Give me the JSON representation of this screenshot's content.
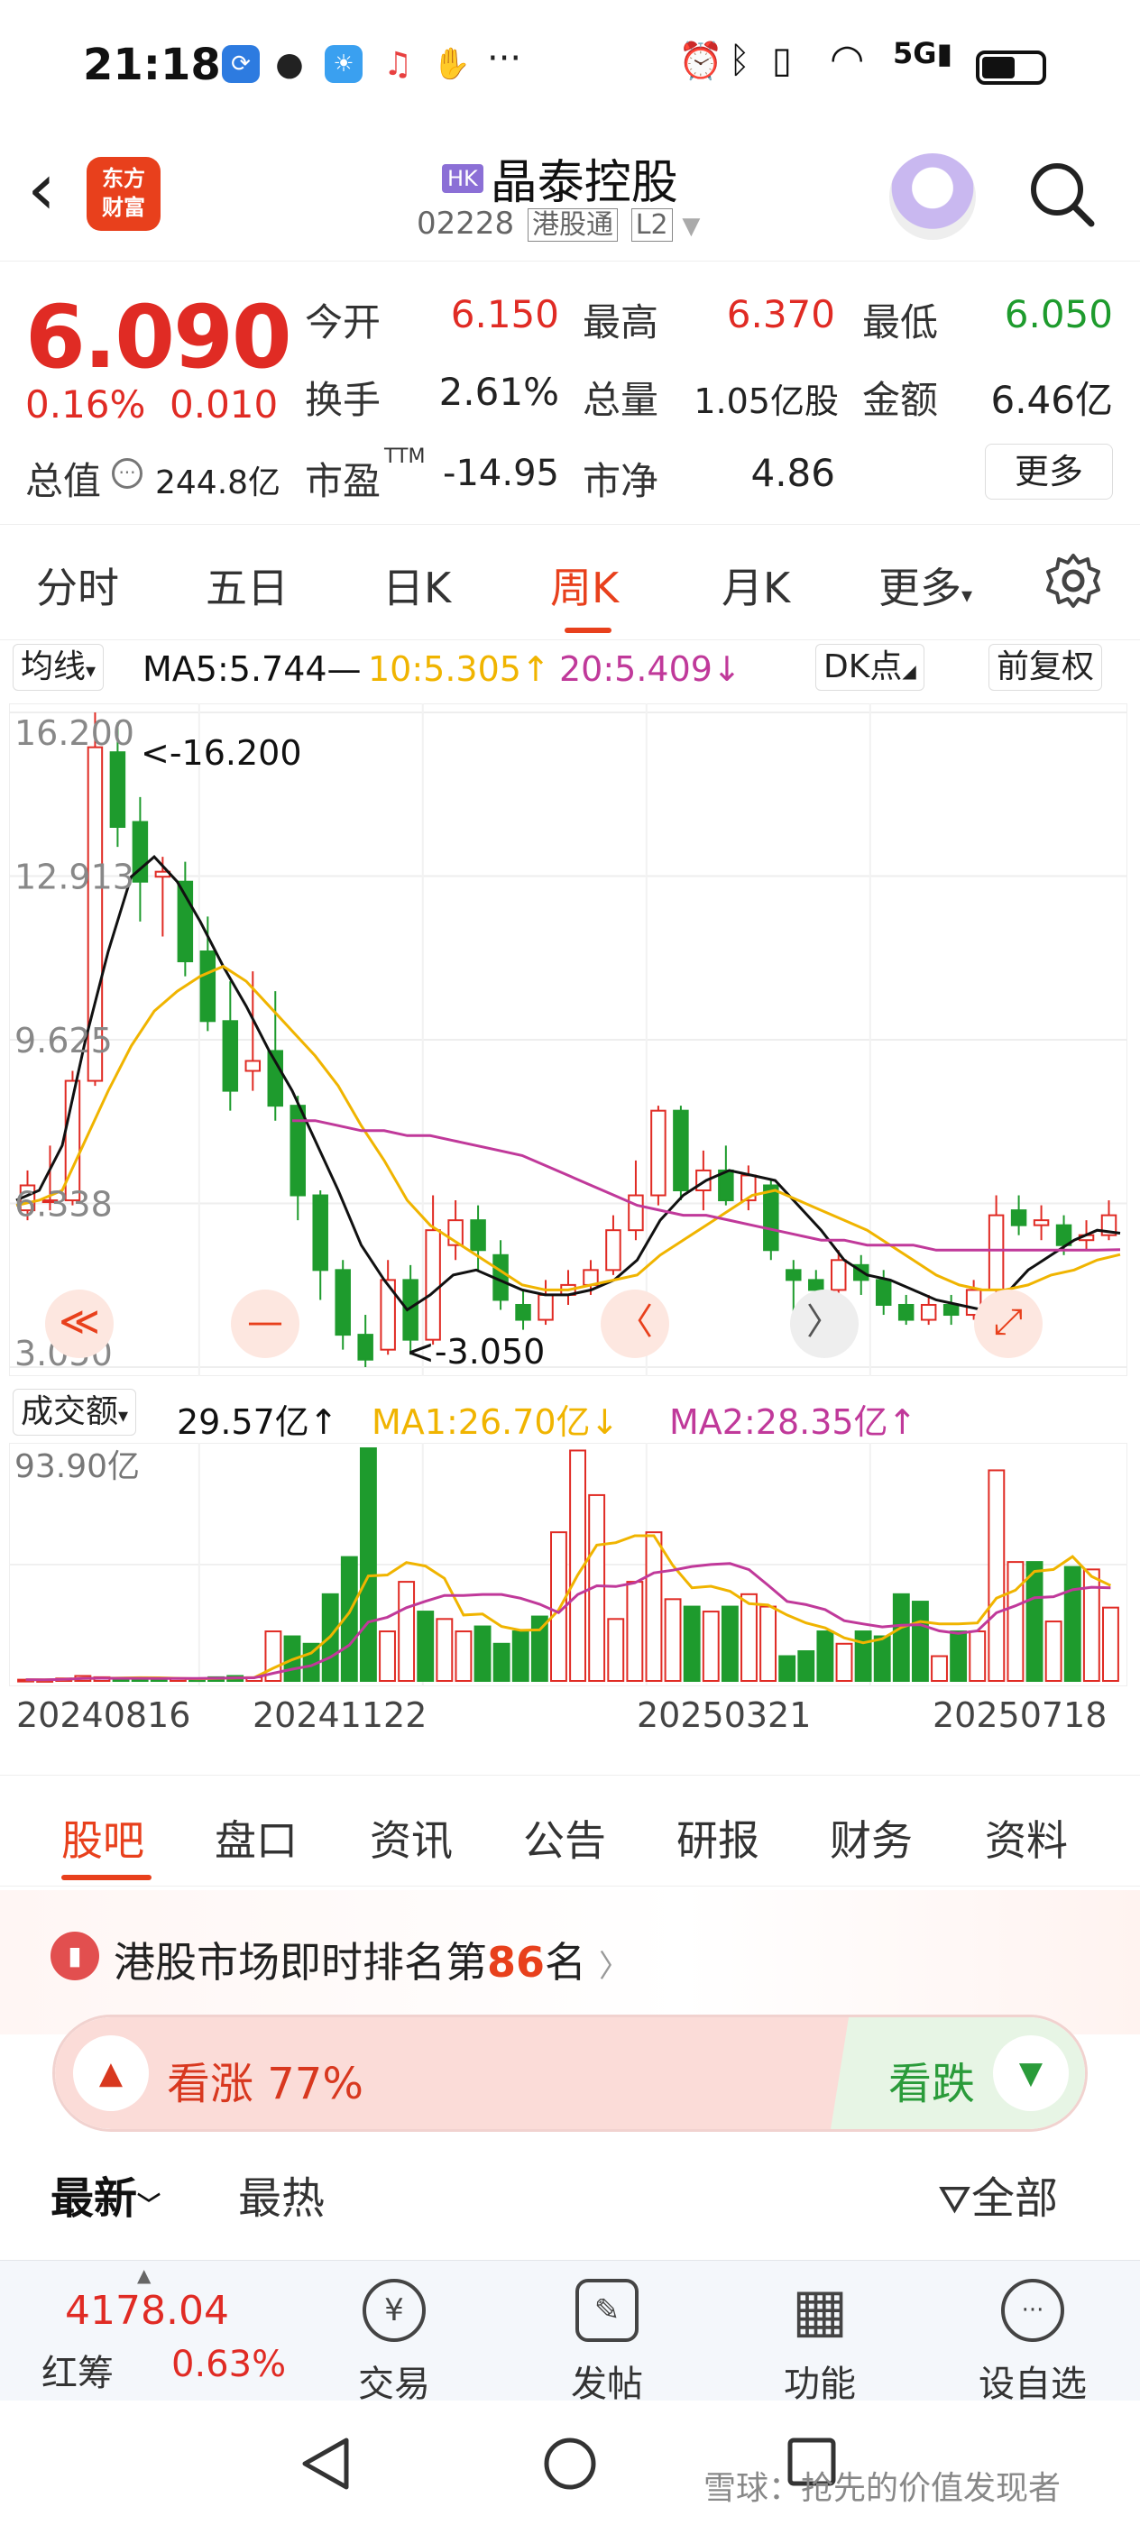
{
  "status_bar": {
    "time": "21:18",
    "app_icons": [
      "sync-icon",
      "wechat-icon",
      "weather-icon",
      "music-icon",
      "hand-icon"
    ],
    "more": "···",
    "right_icons": [
      "alarm-icon",
      "bluetooth-icon",
      "vibrate-icon",
      "wifi-icon",
      "signal-5g-icon",
      "battery-icon"
    ]
  },
  "header": {
    "logo_line1": "东方",
    "logo_line2": "财富",
    "market_badge": "HK",
    "stock_name": "晶泰控股",
    "code": "02228",
    "connect": "港股通",
    "level": "L2"
  },
  "quote": {
    "price": "6.090",
    "change_pct": "0.16%",
    "change_amt": "0.010",
    "open_label": "今开",
    "open": "6.150",
    "high_label": "最高",
    "high": "6.370",
    "low_label": "最低",
    "low": "6.050",
    "turnover_label": "换手",
    "turnover": "2.61%",
    "volume_label": "总量",
    "volume": "1.05亿股",
    "amount_label": "金额",
    "amount": "6.46亿",
    "mktcap_label": "总值",
    "mktcap": "244.8亿",
    "pe_label": "市盈",
    "pe_sup": "TTM",
    "pe": "-14.95",
    "pb_label": "市净",
    "pb": "4.86",
    "more": "更多"
  },
  "k_tabs": [
    "分时",
    "五日",
    "日K",
    "周K",
    "月K",
    "更多"
  ],
  "k_tab_active": "周K",
  "ma_row": {
    "indicator": "均线",
    "ma5": "MA5:5.744—",
    "ma10": "10:5.305↑",
    "ma20": "20:5.409↓",
    "dk": "DK点",
    "adjust": "前复权"
  },
  "volume_row": {
    "indicator": "成交额",
    "value": "29.57亿↑",
    "ma1": "MA1:26.70亿↓",
    "ma2": "MA2:28.35亿↑",
    "axis_max": "93.90亿"
  },
  "chart_data": {
    "type": "candlestick",
    "y_ticks": [
      "16.200",
      "12.913",
      "9.625",
      "6.338",
      "3.050"
    ],
    "ylim": [
      3.05,
      16.2
    ],
    "max_label": "<-16.200",
    "min_label": "<-3.050",
    "x_dates": [
      "20240816",
      "20241122",
      "20250321",
      "20250718"
    ],
    "candles": [
      {
        "o": 6.2,
        "c": 6.7,
        "h": 7.0,
        "l": 6.0
      },
      {
        "o": 6.4,
        "c": 6.4,
        "h": 7.5,
        "l": 6.2
      },
      {
        "o": 6.4,
        "c": 8.8,
        "h": 9.0,
        "l": 6.3
      },
      {
        "o": 8.8,
        "c": 15.5,
        "h": 16.2,
        "l": 8.7
      },
      {
        "o": 15.4,
        "c": 13.9,
        "h": 16.0,
        "l": 13.5
      },
      {
        "o": 14.0,
        "c": 12.8,
        "h": 14.5,
        "l": 12.0
      },
      {
        "o": 12.9,
        "c": 13.0,
        "h": 13.3,
        "l": 11.7
      },
      {
        "o": 12.8,
        "c": 11.2,
        "h": 13.2,
        "l": 10.9
      },
      {
        "o": 11.4,
        "c": 10.0,
        "h": 12.1,
        "l": 9.8
      },
      {
        "o": 10.0,
        "c": 8.6,
        "h": 10.8,
        "l": 8.2
      },
      {
        "o": 9.0,
        "c": 9.2,
        "h": 11.0,
        "l": 8.6
      },
      {
        "o": 9.4,
        "c": 8.3,
        "h": 10.6,
        "l": 8.0
      },
      {
        "o": 8.3,
        "c": 6.5,
        "h": 8.5,
        "l": 6.0
      },
      {
        "o": 6.5,
        "c": 5.0,
        "h": 6.6,
        "l": 4.4
      },
      {
        "o": 5.0,
        "c": 3.7,
        "h": 5.2,
        "l": 3.4
      },
      {
        "o": 3.7,
        "c": 3.2,
        "h": 4.1,
        "l": 3.05
      },
      {
        "o": 3.4,
        "c": 4.8,
        "h": 5.2,
        "l": 3.3
      },
      {
        "o": 4.8,
        "c": 3.6,
        "h": 5.1,
        "l": 3.3
      },
      {
        "o": 3.6,
        "c": 5.8,
        "h": 6.5,
        "l": 3.5
      },
      {
        "o": 5.5,
        "c": 6.0,
        "h": 6.4,
        "l": 5.2
      },
      {
        "o": 6.0,
        "c": 5.4,
        "h": 6.3,
        "l": 5.0
      },
      {
        "o": 5.3,
        "c": 4.4,
        "h": 5.6,
        "l": 4.2
      },
      {
        "o": 4.3,
        "c": 4.0,
        "h": 4.6,
        "l": 3.8
      },
      {
        "o": 4.0,
        "c": 4.5,
        "h": 4.8,
        "l": 3.9
      },
      {
        "o": 4.5,
        "c": 4.7,
        "h": 5.0,
        "l": 4.3
      },
      {
        "o": 4.7,
        "c": 5.0,
        "h": 5.2,
        "l": 4.5
      },
      {
        "o": 5.0,
        "c": 5.8,
        "h": 6.1,
        "l": 4.9
      },
      {
        "o": 5.8,
        "c": 6.5,
        "h": 7.2,
        "l": 5.6
      },
      {
        "o": 6.5,
        "c": 8.2,
        "h": 8.3,
        "l": 6.3
      },
      {
        "o": 8.2,
        "c": 6.6,
        "h": 8.3,
        "l": 6.4
      },
      {
        "o": 6.6,
        "c": 7.0,
        "h": 7.4,
        "l": 6.2
      },
      {
        "o": 7.0,
        "c": 6.4,
        "h": 7.5,
        "l": 6.3
      },
      {
        "o": 6.4,
        "c": 6.9,
        "h": 7.1,
        "l": 6.2
      },
      {
        "o": 6.7,
        "c": 5.4,
        "h": 6.8,
        "l": 5.2
      },
      {
        "o": 5.0,
        "c": 4.8,
        "h": 5.2,
        "l": 4.0
      },
      {
        "o": 4.8,
        "c": 4.6,
        "h": 5.0,
        "l": 4.3
      },
      {
        "o": 4.6,
        "c": 5.2,
        "h": 5.4,
        "l": 4.4
      },
      {
        "o": 5.1,
        "c": 4.8,
        "h": 5.3,
        "l": 4.5
      },
      {
        "o": 4.8,
        "c": 4.3,
        "h": 5.0,
        "l": 4.1
      },
      {
        "o": 4.3,
        "c": 4.0,
        "h": 4.5,
        "l": 3.9
      },
      {
        "o": 4.0,
        "c": 4.3,
        "h": 4.5,
        "l": 3.9
      },
      {
        "o": 4.3,
        "c": 4.1,
        "h": 4.5,
        "l": 3.9
      },
      {
        "o": 4.1,
        "c": 4.6,
        "h": 4.8,
        "l": 4.0
      },
      {
        "o": 4.6,
        "c": 6.1,
        "h": 6.5,
        "l": 4.5
      },
      {
        "o": 6.2,
        "c": 5.9,
        "h": 6.5,
        "l": 5.7
      },
      {
        "o": 5.9,
        "c": 6.0,
        "h": 6.3,
        "l": 5.6
      },
      {
        "o": 5.9,
        "c": 5.5,
        "h": 6.1,
        "l": 5.3
      },
      {
        "o": 5.6,
        "c": 5.7,
        "h": 6.0,
        "l": 5.4
      },
      {
        "o": 5.7,
        "c": 6.1,
        "h": 6.4,
        "l": 5.6
      }
    ],
    "ma_lines": [
      {
        "name": "MA5",
        "color": "#111111",
        "values": [
          6.4,
          6.6,
          7.5,
          9.6,
          11.4,
          12.9,
          13.3,
          12.8,
          12.0,
          11.1,
          10.3,
          9.4,
          8.6,
          7.6,
          6.6,
          5.5,
          4.8,
          4.2,
          4.5,
          4.9,
          5.0,
          4.8,
          4.6,
          4.5,
          4.5,
          4.6,
          4.8,
          5.2,
          6.0,
          6.5,
          6.8,
          7.0,
          6.9,
          6.8,
          6.3,
          5.8,
          5.2,
          4.9,
          4.8,
          4.6,
          4.4,
          4.3,
          4.2,
          4.5,
          5.0,
          5.3,
          5.6,
          5.8,
          5.74
        ]
      },
      {
        "name": "MA10",
        "color": "#f0b400",
        "values": [
          6.3,
          6.4,
          6.6,
          7.6,
          8.6,
          9.5,
          10.2,
          10.6,
          10.9,
          11.1,
          10.8,
          10.3,
          9.8,
          9.3,
          8.7,
          7.9,
          7.2,
          6.4,
          5.9,
          5.6,
          5.3,
          5.0,
          4.7,
          4.6,
          4.6,
          4.7,
          4.8,
          4.9,
          5.3,
          5.6,
          5.9,
          6.2,
          6.5,
          6.6,
          6.4,
          6.2,
          6.0,
          5.8,
          5.5,
          5.2,
          4.9,
          4.7,
          4.6,
          4.6,
          4.7,
          4.9,
          5.0,
          5.2,
          5.31
        ]
      },
      {
        "name": "MA20",
        "color": "#c0399a",
        "values": [
          null,
          null,
          null,
          null,
          null,
          null,
          null,
          null,
          null,
          null,
          null,
          null,
          8.0,
          8.0,
          7.9,
          7.8,
          7.8,
          7.7,
          7.7,
          7.6,
          7.5,
          7.4,
          7.3,
          7.1,
          6.9,
          6.7,
          6.5,
          6.3,
          6.2,
          6.1,
          6.1,
          6.0,
          5.9,
          5.8,
          5.7,
          5.6,
          5.6,
          5.5,
          5.5,
          5.5,
          5.4,
          5.4,
          5.4,
          5.4,
          5.4,
          5.4,
          5.4,
          5.4,
          5.41
        ]
      }
    ],
    "volume": {
      "ylim": [
        0,
        93.9
      ],
      "bars": [
        0.5,
        0.4,
        1.0,
        2.0,
        1.5,
        1.0,
        1.0,
        0.8,
        0.9,
        0.7,
        1.5,
        2.0,
        1.5,
        20,
        18,
        15,
        35,
        50,
        93.9,
        20,
        40,
        28,
        25,
        20,
        22,
        15,
        20,
        26,
        60,
        93,
        75,
        25,
        40,
        60,
        33,
        30,
        28,
        30,
        35,
        30,
        10,
        12,
        20,
        15,
        20,
        18,
        35,
        32,
        10,
        20,
        20,
        85,
        48,
        48,
        24,
        46,
        45,
        29.6
      ]
    }
  },
  "controls": {
    "left_first": "≪",
    "zoom_out": "—",
    "prev": "〈",
    "next": "〉",
    "expand": "⤢"
  },
  "bottom_tabs": [
    "股吧",
    "盘口",
    "资讯",
    "公告",
    "研报",
    "财务",
    "资料"
  ],
  "bottom_tab_active": "股吧",
  "rank": {
    "prefix": "港股市场即时排名第",
    "num": "86",
    "suffix": "名",
    "chevron": "〉"
  },
  "vote": {
    "up": "看涨 77%",
    "down": "看跌",
    "up_pct": 77
  },
  "sort": {
    "latest": "最新",
    "hot": "最热",
    "filter": "全部"
  },
  "toolbar": {
    "index_value": "4178.04",
    "index_name": "红筹",
    "index_pct": "0.63%",
    "items": [
      {
        "icon": "trade-icon",
        "glyph": "¥",
        "label": "交易"
      },
      {
        "icon": "post-icon",
        "glyph": "✎",
        "label": "发帖"
      },
      {
        "icon": "function-icon",
        "glyph": "▦",
        "label": "功能"
      },
      {
        "icon": "watchlist-icon",
        "glyph": "···",
        "label": "设自选"
      }
    ]
  },
  "system_nav": {
    "watermark": "雪球：抢先的价值发现者"
  },
  "colors": {
    "up": "#e02b24",
    "down": "#1e9b2d",
    "accent": "#e8401c"
  }
}
